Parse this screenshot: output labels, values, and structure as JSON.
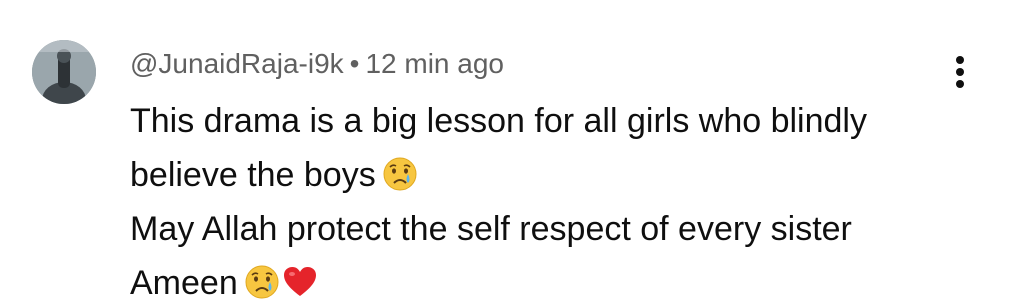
{
  "comment": {
    "author": "@JunaidRaja-i9k",
    "separator": "•",
    "time": "12 min ago",
    "lines": [
      "This drama is a big lesson for all girls who blindly",
      "believe the boys",
      "May Allah protect the self respect of every sister",
      "Ameen"
    ],
    "avatar_icon": "profile-photo",
    "menu_icon": "more-vertical-icon",
    "emojis": [
      "crying-face",
      "crying-face",
      "red-heart"
    ]
  }
}
